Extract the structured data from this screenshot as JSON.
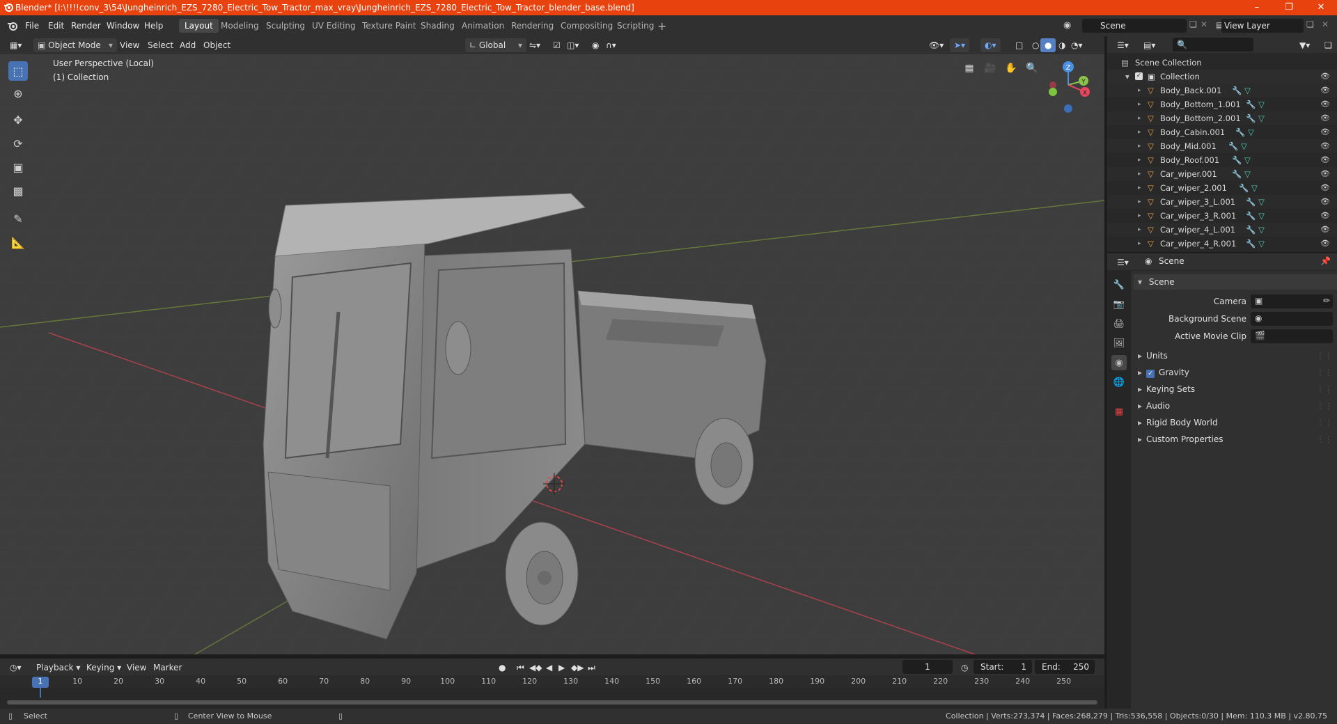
{
  "window": {
    "title": "Blender* [I:\\!!!!conv_3\\54\\Jungheinrich_EZS_7280_Electric_Tow_Tractor_max_vray\\Jungheinrich_EZS_7280_Electric_Tow_Tractor_blender_base.blend]",
    "minimize": "–",
    "maximize": "❐",
    "close": "✕"
  },
  "menu": [
    "File",
    "Edit",
    "Render",
    "Window",
    "Help"
  ],
  "workspaces": [
    "Layout",
    "Modeling",
    "Sculpting",
    "UV Editing",
    "Texture Paint",
    "Shading",
    "Animation",
    "Rendering",
    "Compositing",
    "Scripting"
  ],
  "active_workspace": "Layout",
  "scene_field": "Scene",
  "view_layer_field": "View Layer",
  "viewport_header": {
    "mode": "Object Mode",
    "menus": [
      "View",
      "Select",
      "Add",
      "Object"
    ],
    "transform_orientation": "Global"
  },
  "viewport": {
    "perspective_label": "User Perspective (Local)",
    "collection_label": "(1) Collection",
    "gizmo": {
      "z": "Z",
      "y": "Y",
      "x": "X"
    }
  },
  "outliner": {
    "root": "Scene Collection",
    "collection": "Collection",
    "objects": [
      "Body_Back.001",
      "Body_Bottom_1.001",
      "Body_Bottom_2.001",
      "Body_Cabin.001",
      "Body_Mid.001",
      "Body_Roof.001",
      "Car_wiper.001",
      "Car_wiper_2.001",
      "Car_wiper_3_L.001",
      "Car_wiper_3_R.001",
      "Car_wiper_4_L.001",
      "Car_wiper_4_R.001"
    ]
  },
  "properties": {
    "context": "Scene",
    "panel_title": "Scene",
    "camera_label": "Camera",
    "background_scene_label": "Background Scene",
    "active_movie_clip_label": "Active Movie Clip",
    "sections": [
      "Units",
      "Gravity",
      "Keying Sets",
      "Audio",
      "Rigid Body World",
      "Custom Properties"
    ],
    "gravity_checked": true
  },
  "timeline": {
    "menus": [
      "Playback",
      "Keying",
      "View",
      "Marker"
    ],
    "current_frame": "1",
    "start_label": "Start:",
    "start": "1",
    "end_label": "End:",
    "end": "250",
    "ruler": [
      "1",
      "10",
      "20",
      "30",
      "40",
      "50",
      "60",
      "70",
      "80",
      "90",
      "100",
      "110",
      "120",
      "130",
      "140",
      "150",
      "160",
      "170",
      "180",
      "190",
      "200",
      "210",
      "220",
      "230",
      "240",
      "250"
    ]
  },
  "status": {
    "select": "Select",
    "center_view": "Center View to Mouse",
    "stats": "Collection | Verts:273,374 | Faces:268,279 | Tris:536,558 | Objects:0/30 | Mem: 110.3 MB | v2.80.75"
  },
  "colors": {
    "titlebar": "#e8420f",
    "accent": "#4772b3",
    "x_axis": "#e8475f",
    "y_axis": "#8bc34a",
    "z_axis": "#4a90e2",
    "object_icon": "#e8a04d",
    "mesh_icon": "#4ec9b0"
  }
}
